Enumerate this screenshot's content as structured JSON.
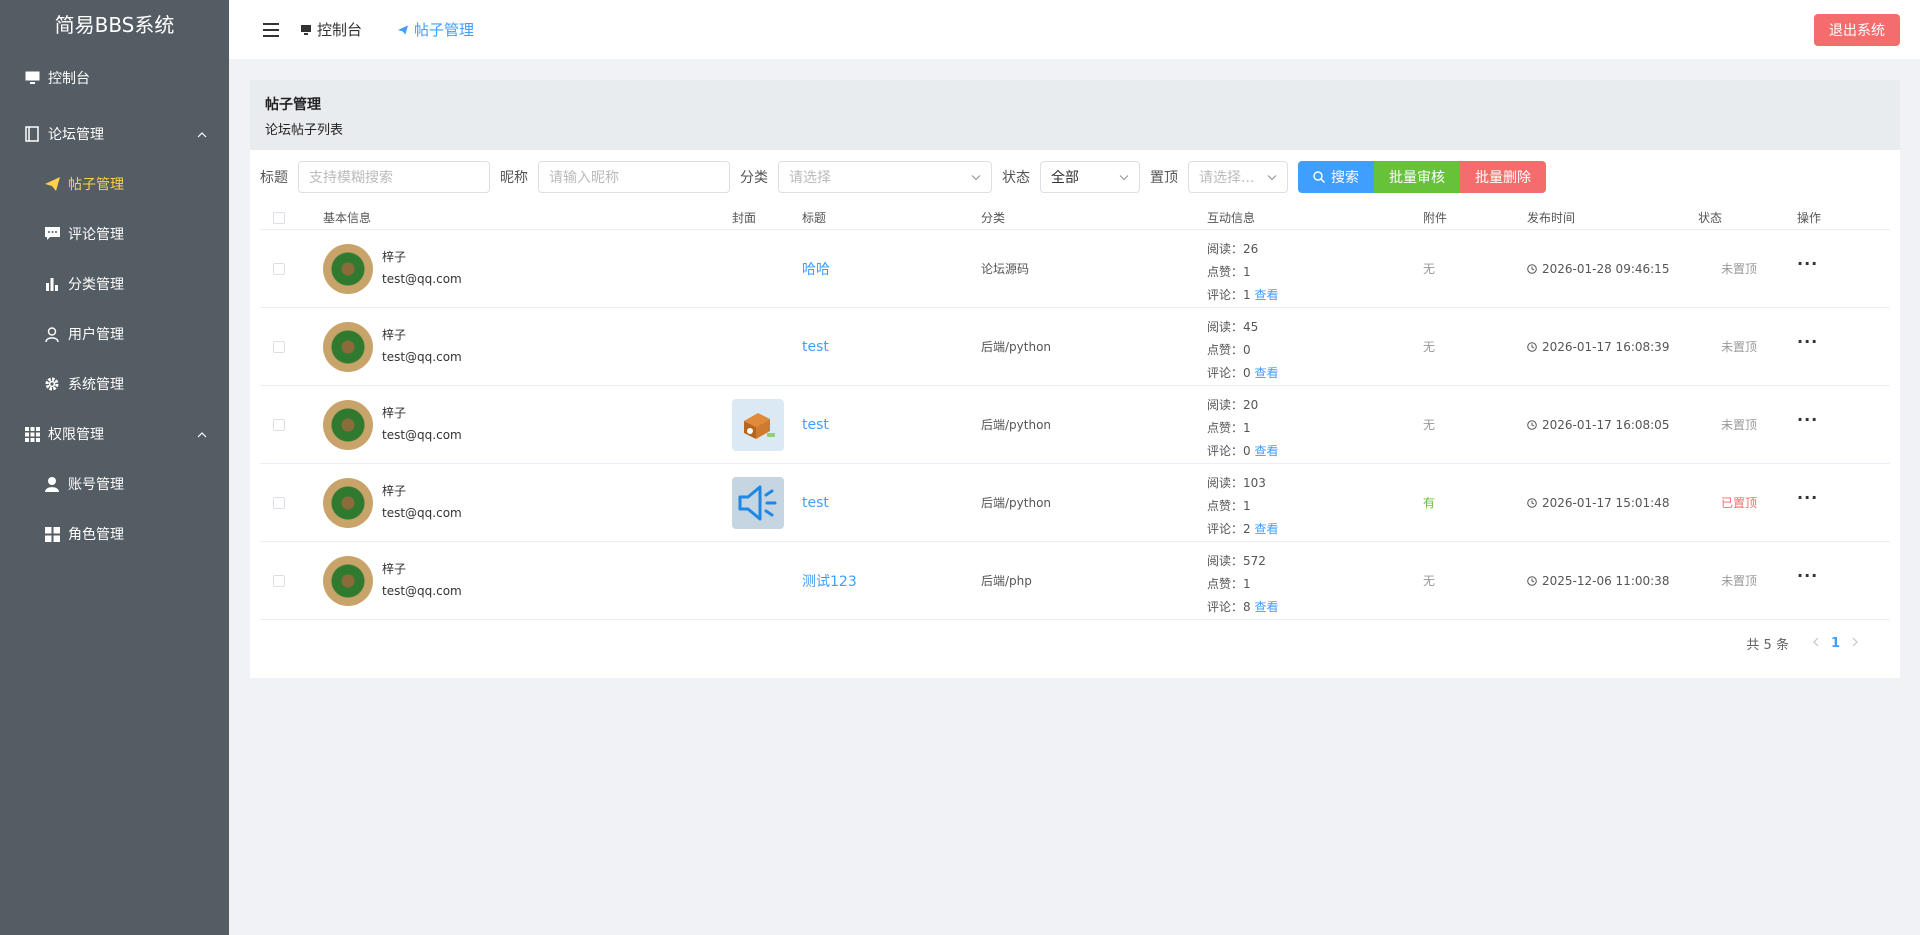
{
  "app": {
    "title": "简易BBS系统"
  },
  "sidebar": {
    "items": [
      {
        "label": "控制台",
        "icon": "monitor-icon"
      },
      {
        "label": "论坛管理",
        "icon": "notebook-icon"
      },
      {
        "label": "帖子管理",
        "icon": "send-icon"
      },
      {
        "label": "评论管理",
        "icon": "chat-icon"
      },
      {
        "label": "分类管理",
        "icon": "bar-chart-icon"
      },
      {
        "label": "用户管理",
        "icon": "user-icon"
      },
      {
        "label": "系统管理",
        "icon": "gear-icon"
      },
      {
        "label": "权限管理",
        "icon": "grid-icon"
      },
      {
        "label": "账号管理",
        "icon": "user-solid-icon"
      },
      {
        "label": "角色管理",
        "icon": "apps-icon"
      }
    ],
    "active_color": "#ffd04b",
    "background": "#545c64"
  },
  "header": {
    "breadcrumb": [
      "控制台",
      "帖子管理"
    ],
    "logout_label": "退出系统"
  },
  "panel": {
    "title": "帖子管理",
    "subtitle": "论坛帖子列表"
  },
  "filters": {
    "title_label": "标题",
    "title_placeholder": "支持模糊搜索",
    "nickname_label": "昵称",
    "nickname_placeholder": "请输入昵称",
    "category_label": "分类",
    "category_placeholder": "请选择",
    "status_label": "状态",
    "status_value": "全部",
    "pin_label": "置顶",
    "pin_placeholder": "请选择...",
    "search_label": "搜索",
    "batch_review_label": "批量审核",
    "batch_delete_label": "批量删除"
  },
  "table": {
    "headers": [
      "基本信息",
      "封面",
      "标题",
      "分类",
      "互动信息",
      "附件",
      "发布时间",
      "状态",
      "操作"
    ],
    "read_prefix": "阅读：",
    "like_prefix": "点赞：",
    "comment_prefix": "评论：",
    "view_label": "查看",
    "rows": [
      {
        "name": "梓子",
        "email": "test@qq.com",
        "cover": "",
        "title": "哈哈",
        "category": "论坛源码",
        "reads": "26",
        "likes": "1",
        "comments": "1",
        "attachment": "无",
        "time": "2026-01-28 09:46:15",
        "status": "未置顶"
      },
      {
        "name": "梓子",
        "email": "test@qq.com",
        "cover": "",
        "title": "test",
        "category": "后端/python",
        "reads": "45",
        "likes": "0",
        "comments": "0",
        "attachment": "无",
        "time": "2026-01-17 16:08:39",
        "status": "未置顶"
      },
      {
        "name": "梓子",
        "email": "test@qq.com",
        "cover": "box-image",
        "title": "test",
        "category": "后端/python",
        "reads": "20",
        "likes": "1",
        "comments": "0",
        "attachment": "无",
        "time": "2026-01-17 16:08:05",
        "status": "未置顶"
      },
      {
        "name": "梓子",
        "email": "test@qq.com",
        "cover": "speaker-image",
        "title": "test",
        "category": "后端/python",
        "reads": "103",
        "likes": "1",
        "comments": "2",
        "attachment": "有",
        "time": "2026-01-17 15:01:48",
        "status": "已置顶"
      },
      {
        "name": "梓子",
        "email": "test@qq.com",
        "cover": "",
        "title": "测试123",
        "category": "后端/php",
        "reads": "572",
        "likes": "1",
        "comments": "8",
        "attachment": "无",
        "time": "2025-12-06 11:00:38",
        "status": "未置顶"
      }
    ]
  },
  "pagination": {
    "total_text": "共 5 条",
    "current_page": "1"
  }
}
